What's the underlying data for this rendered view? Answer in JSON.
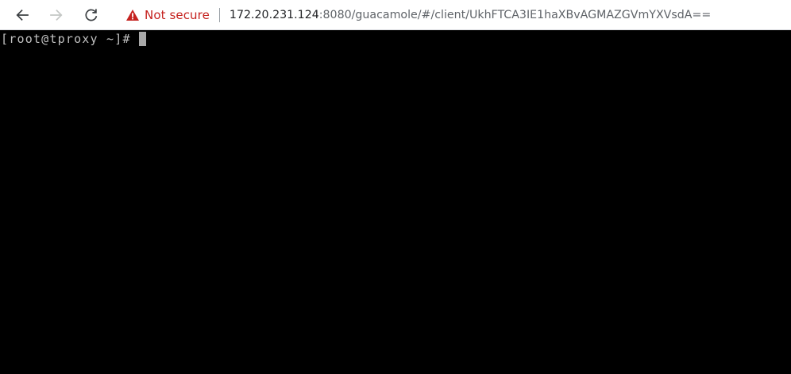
{
  "browser": {
    "nav": {
      "back_icon": "arrow-left-icon",
      "forward_icon": "arrow-right-icon",
      "reload_icon": "reload-icon"
    },
    "security": {
      "icon": "warning-triangle-icon",
      "label": "Not secure",
      "color": "#c5221f"
    },
    "url": {
      "host": "172.20.231.124",
      "rest": ":8080/guacamole/#/client/UkhFTCA3IE1haXBvAGMAZGVmYXVsdA=="
    }
  },
  "terminal": {
    "prompt": "[root@tproxy ~]#",
    "background": "#000000",
    "foreground": "#c0c0c0"
  }
}
